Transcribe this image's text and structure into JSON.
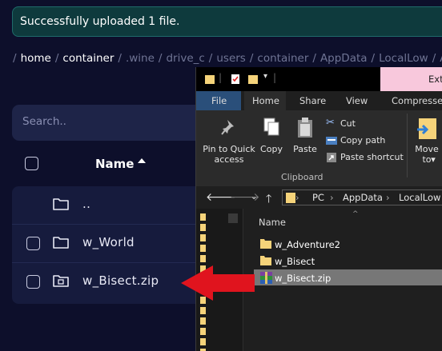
{
  "toast": {
    "message": "Successfully uploaded 1 file."
  },
  "breadcrumb": [
    {
      "label": "home",
      "active": true
    },
    {
      "label": "container",
      "active": true
    },
    {
      "label": ".wine",
      "active": false
    },
    {
      "label": "drive_c",
      "active": false
    },
    {
      "label": "users",
      "active": false
    },
    {
      "label": "container",
      "active": false
    },
    {
      "label": "AppData",
      "active": false
    },
    {
      "label": "LocalLow",
      "active": false
    },
    {
      "label": "As",
      "active": false
    }
  ],
  "search": {
    "placeholder": "Search.."
  },
  "file_table": {
    "name_header": "Name",
    "rows": [
      {
        "name": "..",
        "icon": "folder-icon",
        "has_checkbox": false
      },
      {
        "name": "w_World",
        "icon": "folder-icon",
        "has_checkbox": true
      },
      {
        "name": "w_Bisect.zip",
        "icon": "zip-archive-icon",
        "has_checkbox": true
      }
    ]
  },
  "explorer": {
    "contextual_tab": "Ext",
    "tabs": [
      "File",
      "Home",
      "Share",
      "View",
      "Compressed"
    ],
    "ribbon": {
      "pin_label": "Pin to Quick access",
      "copy_label": "Copy",
      "paste_label": "Paste",
      "cut_label": "Cut",
      "copy_path_label": "Copy path",
      "paste_shortcut_label": "Paste shortcut",
      "move_to_label": "Move to",
      "group_label": "Clipboard"
    },
    "address": [
      "PC",
      "AppData",
      "LocalLow"
    ],
    "list_header": "Name",
    "items": [
      {
        "name": "w_Adventure2",
        "icon": "folder-icon",
        "selected": false
      },
      {
        "name": "w_Bisect",
        "icon": "folder-icon",
        "selected": false
      },
      {
        "name": "w_Bisect.zip",
        "icon": "winrar-archive-icon",
        "selected": true
      }
    ]
  },
  "colors": {
    "page_bg": "#0d0f2b",
    "toast_bg": "#0e3a3d",
    "panel_bg": "#161b3d",
    "folder_yellow": "#f5d37a",
    "arrow_red": "#e0141e",
    "selection_gray": "#777777"
  }
}
